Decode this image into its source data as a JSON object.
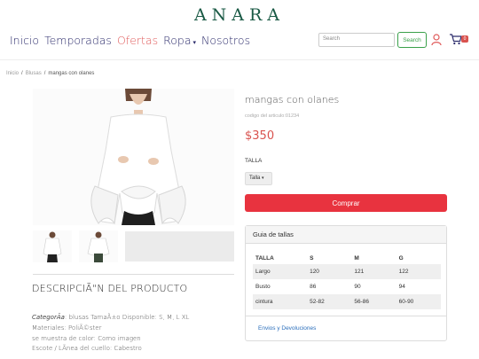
{
  "header": {
    "logo": "ANARA",
    "nav": [
      {
        "label": "Inicio",
        "active": false
      },
      {
        "label": "Temporadas",
        "active": false
      },
      {
        "label": "Ofertas",
        "active": true
      },
      {
        "label": "Ropa",
        "active": false
      },
      {
        "label": "Nosotros",
        "active": false
      }
    ],
    "dropdown_caret": "▾",
    "search_placeholder": "Search",
    "search_button": "Search",
    "cart_count": "0"
  },
  "breadcrumb": {
    "items": [
      "Inicio",
      "Blusas",
      "mangas con olanes"
    ],
    "separator": "/"
  },
  "product": {
    "name": "mangas con olanes",
    "code": "codigo del articulo:01234",
    "price": "$350",
    "size_label": "TALLA",
    "size_selected": "Talla",
    "buy_button": "Comprar"
  },
  "description": {
    "title": "DESCRIPCIÃ\"N DEL PRODUCTO",
    "lines": [
      {
        "italic_prefix": "CategorÃ­a",
        "text": ": blusas TamaÃ±o Disponible: S, M, L XL"
      },
      {
        "italic_prefix": "",
        "text": "Materiales: PoliÃ©ster"
      },
      {
        "italic_prefix": "",
        "text": "se muestra de color: Como imagen"
      },
      {
        "italic_prefix": "",
        "text": "Escote / LÃ­nea del cuello: Cabestro"
      }
    ]
  },
  "size_guide": {
    "title": "Guia de tallas",
    "headers": [
      "TALLA",
      "S",
      "M",
      "G"
    ],
    "rows": [
      [
        "Largo",
        "120",
        "121",
        "122"
      ],
      [
        "Busto",
        "86",
        "90",
        "94"
      ],
      [
        "cintura",
        "52-82",
        "56-86",
        "60-90"
      ]
    ],
    "footer_link": "Envios y Devoluciones"
  },
  "colors": {
    "brand": "#1a5a45",
    "nav": "#2b2b6b",
    "active_nav": "#e05a5a",
    "price": "#d9534f",
    "buy_button": "#e8333f",
    "search_button": "#3aa04a",
    "link": "#2a6ebb"
  }
}
